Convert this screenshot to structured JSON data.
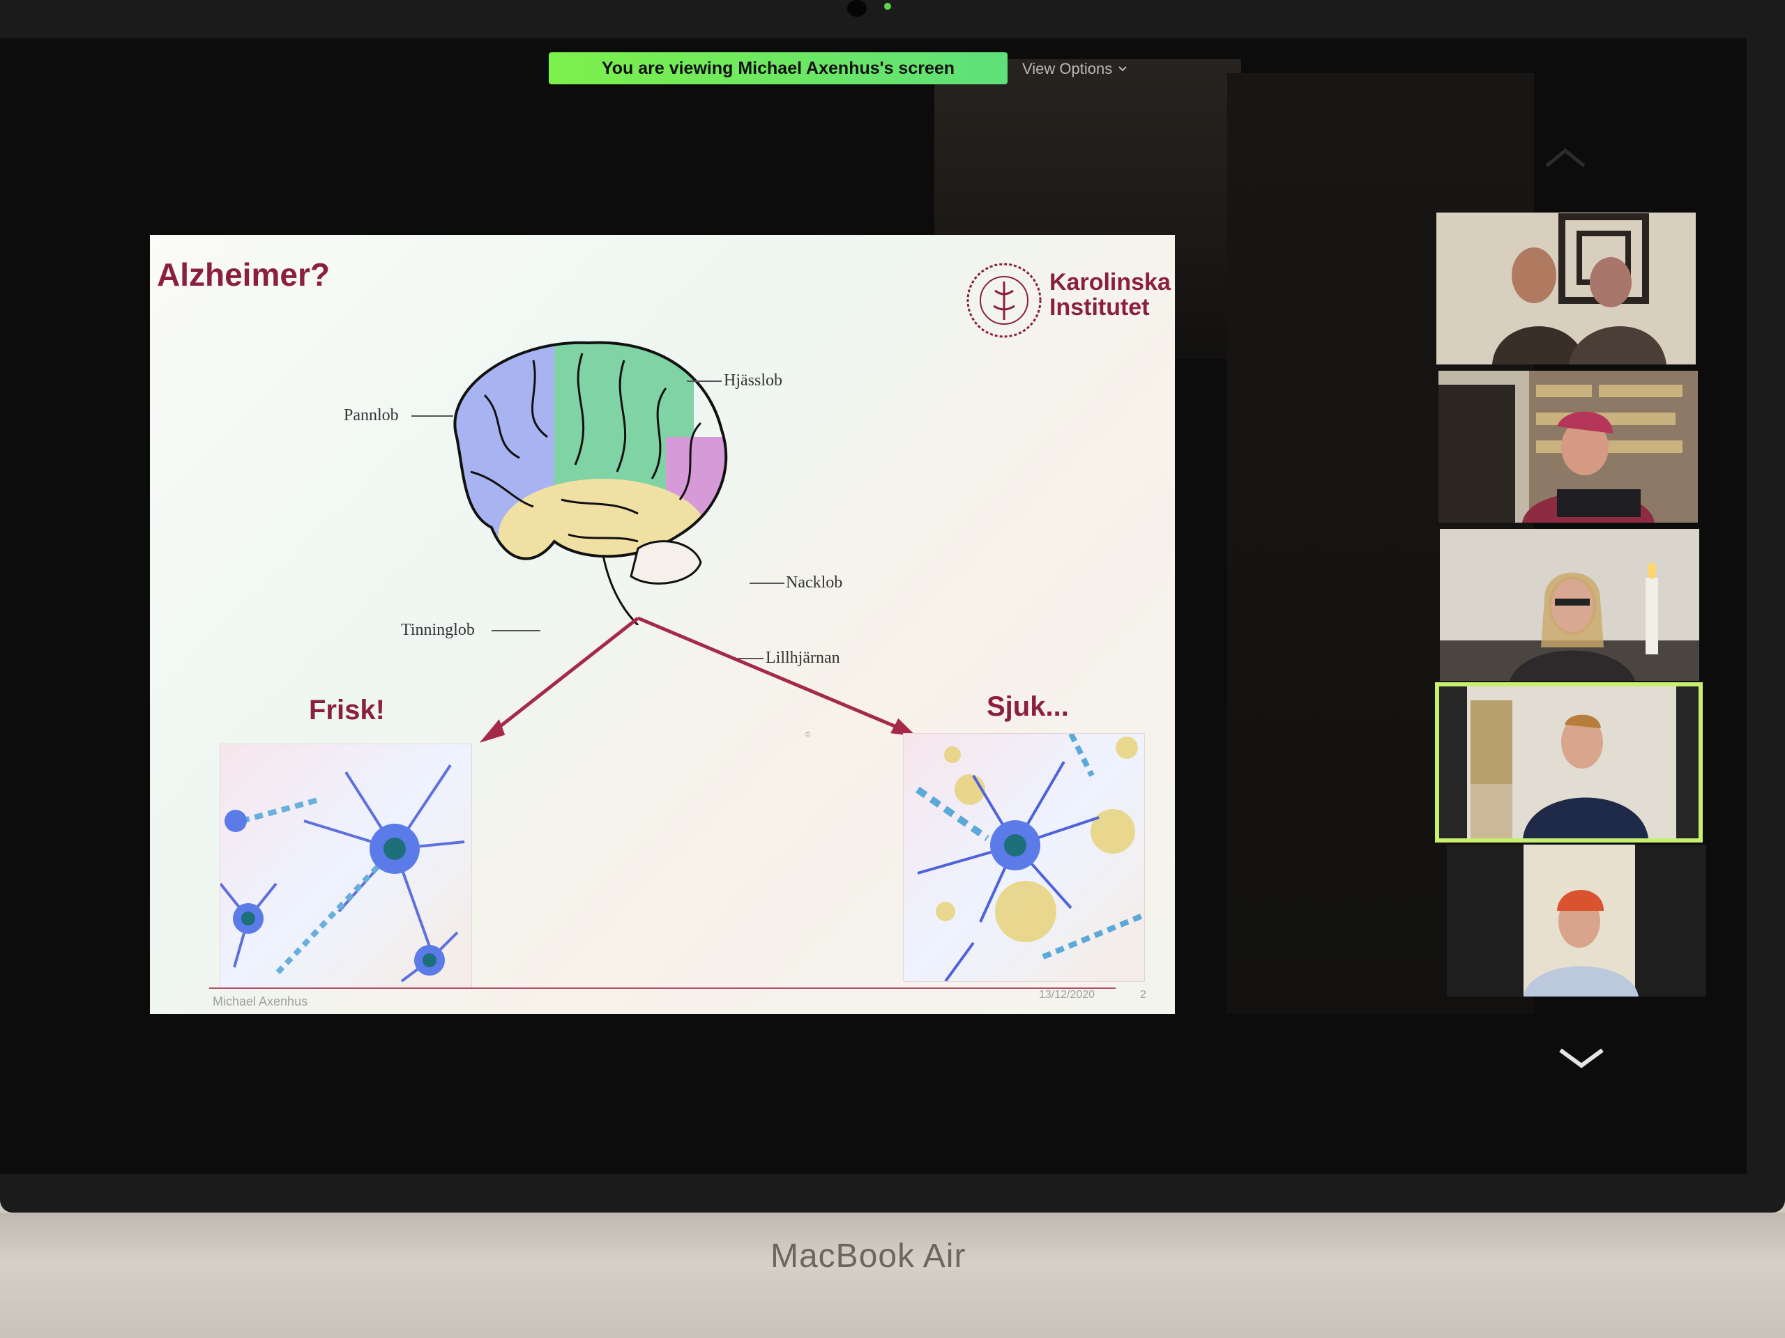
{
  "share_banner": {
    "text": "You are viewing Michael Axenhus's screen"
  },
  "view_options": {
    "label": "View Options"
  },
  "slide": {
    "title": "Alzheimer?",
    "logo": {
      "line1": "Karolinska",
      "line2": "Institutet"
    },
    "lobes": {
      "top": "Hjässlob",
      "front": "Pannlob",
      "back": "Nacklob",
      "temporal": "Tinninglob",
      "cerebellum": "Lillhjärnan"
    },
    "healthy_label": "Frisk!",
    "sick_label": "Sjuk...",
    "footer": {
      "author": "Michael Axenhus",
      "date": "13/12/2020",
      "page": "2"
    }
  },
  "participants": [
    {
      "id": "p1",
      "active": false
    },
    {
      "id": "p2",
      "active": false
    },
    {
      "id": "p3",
      "active": false
    },
    {
      "id": "p4",
      "active": true
    },
    {
      "id": "p5",
      "active": false
    }
  ],
  "device_brand": "MacBook Air",
  "icons": {
    "scroll_up": "chevron-up-icon",
    "scroll_down": "chevron-down-icon",
    "view_options_caret": "chevron-down-icon"
  },
  "colors": {
    "banner": "#7df04a",
    "slide_accent": "#8a1f40",
    "active_speaker": "#c8ef70"
  }
}
